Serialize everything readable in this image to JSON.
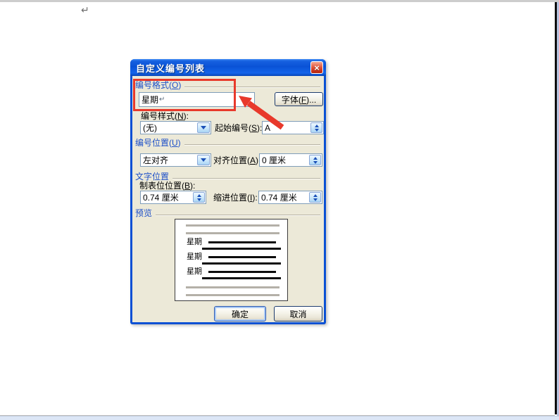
{
  "page": {
    "paragraph_mark": "↵"
  },
  "annotation": {
    "color": "#e8392b"
  },
  "dialog": {
    "title": "自定义编号列表",
    "close_glyph": "×",
    "number_format": {
      "label_pre": "编号格式(",
      "label_key": "O",
      "label_post": ")",
      "value": "星期",
      "return_mark": "↵"
    },
    "font_button": {
      "pre": "字体(",
      "key": "F",
      "post": ")..."
    },
    "number_style": {
      "label_pre": "编号样式(",
      "label_key": "N",
      "label_post": "):",
      "value": "(无)"
    },
    "start_number": {
      "label_pre": "起始编号(",
      "label_key": "S",
      "label_post": "):",
      "value": "A"
    },
    "number_position_group": {
      "pre": "编号位置(",
      "key": "U",
      "post": ")"
    },
    "alignment": {
      "value": "左对齐"
    },
    "align_position": {
      "label_pre": "对齐位置(",
      "label_key": "A",
      "label_post": "):",
      "value": "0 厘米"
    },
    "text_position_group": {
      "label": "文字位置"
    },
    "tab_position": {
      "label_pre": "制表位位置(",
      "label_key": "B",
      "label_post": "):",
      "value": "0.74 厘米"
    },
    "indent_position": {
      "label_pre": "缩进位置(",
      "label_key": "I",
      "label_post": "):",
      "value": "0.74 厘米"
    },
    "preview_group": {
      "label": "预览"
    },
    "preview_items": [
      "星期",
      "星期",
      "星期"
    ],
    "ok_label": "确定",
    "cancel_label": "取消"
  }
}
